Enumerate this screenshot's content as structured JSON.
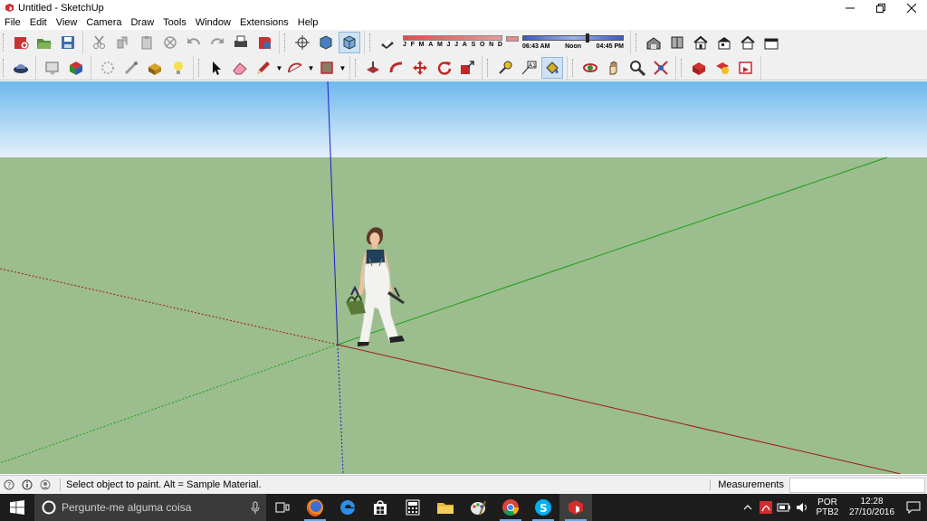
{
  "window": {
    "title": "Untitled - SketchUp"
  },
  "menu": [
    "File",
    "Edit",
    "View",
    "Camera",
    "Draw",
    "Tools",
    "Window",
    "Extensions",
    "Help"
  ],
  "shadow": {
    "months": [
      "J",
      "F",
      "M",
      "A",
      "M",
      "J",
      "J",
      "A",
      "S",
      "O",
      "N",
      "D"
    ],
    "time_start": "06:43 AM",
    "time_mid": "Noon",
    "time_end": "04:45 PM"
  },
  "statusbar": {
    "hint": "Select object to paint. Alt = Sample Material.",
    "measurements_label": "Measurements",
    "measurements_value": ""
  },
  "taskbar": {
    "search_placeholder": "Pergunte-me alguma coisa",
    "lang_top": "POR",
    "lang_bottom": "PTB2",
    "time": "12:28",
    "date": "27/10/2016"
  },
  "colors": {
    "sky_top": "#6db8ec",
    "sky_bottom": "#e4f1fb",
    "ground": "#9cbd8d",
    "axis_red": "#a01818",
    "axis_green": "#1aa018",
    "axis_blue": "#1c1cc8",
    "taskbar": "#1d1d1d"
  },
  "icons": {
    "toolbar_row1": [
      "new-model-icon",
      "open-icon",
      "save-icon",
      "cut-icon",
      "copy-icon",
      "paste-icon",
      "erase-icon",
      "undo-icon",
      "redo-icon",
      "print-icon",
      "model-info-icon",
      "orbit-icon",
      "section-plane-icon",
      "shadow-icon",
      "shadow-toggle-icon",
      "iso-view-icon",
      "top-view-icon",
      "front-view-icon",
      "right-view-icon",
      "back-view-icon",
      "left-view-icon"
    ],
    "toolbar_row2": [
      "geo-location-icon",
      "add-location-icon",
      "3d-warehouse-icon",
      "extension-warehouse-icon",
      "tape-icon",
      "components-icon",
      "bulb-icon",
      "select-icon",
      "eraser-icon",
      "pencil-icon",
      "arc-icon",
      "rectangle-icon",
      "push-pull-icon",
      "follow-me-icon",
      "move-icon",
      "rotate-icon",
      "scale-icon",
      "tape-measure-icon",
      "text-icon",
      "paint-bucket-icon",
      "orbit2-icon",
      "pan-icon",
      "zoom-icon",
      "zoom-extents-icon",
      "get-models-icon",
      "share-model-icon",
      "layout-icon"
    ]
  }
}
